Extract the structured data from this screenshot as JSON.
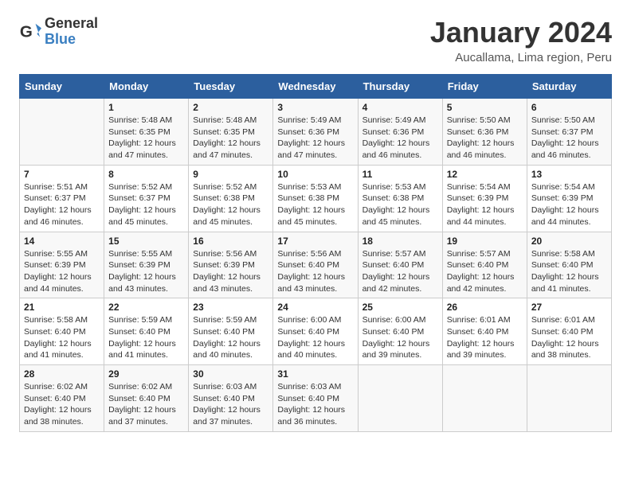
{
  "logo": {
    "text_general": "General",
    "text_blue": "Blue"
  },
  "title": "January 2024",
  "subtitle": "Aucallama, Lima region, Peru",
  "days_of_week": [
    "Sunday",
    "Monday",
    "Tuesday",
    "Wednesday",
    "Thursday",
    "Friday",
    "Saturday"
  ],
  "weeks": [
    [
      {
        "day": "",
        "info": ""
      },
      {
        "day": "1",
        "info": "Sunrise: 5:48 AM\nSunset: 6:35 PM\nDaylight: 12 hours\nand 47 minutes."
      },
      {
        "day": "2",
        "info": "Sunrise: 5:48 AM\nSunset: 6:35 PM\nDaylight: 12 hours\nand 47 minutes."
      },
      {
        "day": "3",
        "info": "Sunrise: 5:49 AM\nSunset: 6:36 PM\nDaylight: 12 hours\nand 47 minutes."
      },
      {
        "day": "4",
        "info": "Sunrise: 5:49 AM\nSunset: 6:36 PM\nDaylight: 12 hours\nand 46 minutes."
      },
      {
        "day": "5",
        "info": "Sunrise: 5:50 AM\nSunset: 6:36 PM\nDaylight: 12 hours\nand 46 minutes."
      },
      {
        "day": "6",
        "info": "Sunrise: 5:50 AM\nSunset: 6:37 PM\nDaylight: 12 hours\nand 46 minutes."
      }
    ],
    [
      {
        "day": "7",
        "info": "Sunrise: 5:51 AM\nSunset: 6:37 PM\nDaylight: 12 hours\nand 46 minutes."
      },
      {
        "day": "8",
        "info": "Sunrise: 5:52 AM\nSunset: 6:37 PM\nDaylight: 12 hours\nand 45 minutes."
      },
      {
        "day": "9",
        "info": "Sunrise: 5:52 AM\nSunset: 6:38 PM\nDaylight: 12 hours\nand 45 minutes."
      },
      {
        "day": "10",
        "info": "Sunrise: 5:53 AM\nSunset: 6:38 PM\nDaylight: 12 hours\nand 45 minutes."
      },
      {
        "day": "11",
        "info": "Sunrise: 5:53 AM\nSunset: 6:38 PM\nDaylight: 12 hours\nand 45 minutes."
      },
      {
        "day": "12",
        "info": "Sunrise: 5:54 AM\nSunset: 6:39 PM\nDaylight: 12 hours\nand 44 minutes."
      },
      {
        "day": "13",
        "info": "Sunrise: 5:54 AM\nSunset: 6:39 PM\nDaylight: 12 hours\nand 44 minutes."
      }
    ],
    [
      {
        "day": "14",
        "info": "Sunrise: 5:55 AM\nSunset: 6:39 PM\nDaylight: 12 hours\nand 44 minutes."
      },
      {
        "day": "15",
        "info": "Sunrise: 5:55 AM\nSunset: 6:39 PM\nDaylight: 12 hours\nand 43 minutes."
      },
      {
        "day": "16",
        "info": "Sunrise: 5:56 AM\nSunset: 6:39 PM\nDaylight: 12 hours\nand 43 minutes."
      },
      {
        "day": "17",
        "info": "Sunrise: 5:56 AM\nSunset: 6:40 PM\nDaylight: 12 hours\nand 43 minutes."
      },
      {
        "day": "18",
        "info": "Sunrise: 5:57 AM\nSunset: 6:40 PM\nDaylight: 12 hours\nand 42 minutes."
      },
      {
        "day": "19",
        "info": "Sunrise: 5:57 AM\nSunset: 6:40 PM\nDaylight: 12 hours\nand 42 minutes."
      },
      {
        "day": "20",
        "info": "Sunrise: 5:58 AM\nSunset: 6:40 PM\nDaylight: 12 hours\nand 41 minutes."
      }
    ],
    [
      {
        "day": "21",
        "info": "Sunrise: 5:58 AM\nSunset: 6:40 PM\nDaylight: 12 hours\nand 41 minutes."
      },
      {
        "day": "22",
        "info": "Sunrise: 5:59 AM\nSunset: 6:40 PM\nDaylight: 12 hours\nand 41 minutes."
      },
      {
        "day": "23",
        "info": "Sunrise: 5:59 AM\nSunset: 6:40 PM\nDaylight: 12 hours\nand 40 minutes."
      },
      {
        "day": "24",
        "info": "Sunrise: 6:00 AM\nSunset: 6:40 PM\nDaylight: 12 hours\nand 40 minutes."
      },
      {
        "day": "25",
        "info": "Sunrise: 6:00 AM\nSunset: 6:40 PM\nDaylight: 12 hours\nand 39 minutes."
      },
      {
        "day": "26",
        "info": "Sunrise: 6:01 AM\nSunset: 6:40 PM\nDaylight: 12 hours\nand 39 minutes."
      },
      {
        "day": "27",
        "info": "Sunrise: 6:01 AM\nSunset: 6:40 PM\nDaylight: 12 hours\nand 38 minutes."
      }
    ],
    [
      {
        "day": "28",
        "info": "Sunrise: 6:02 AM\nSunset: 6:40 PM\nDaylight: 12 hours\nand 38 minutes."
      },
      {
        "day": "29",
        "info": "Sunrise: 6:02 AM\nSunset: 6:40 PM\nDaylight: 12 hours\nand 37 minutes."
      },
      {
        "day": "30",
        "info": "Sunrise: 6:03 AM\nSunset: 6:40 PM\nDaylight: 12 hours\nand 37 minutes."
      },
      {
        "day": "31",
        "info": "Sunrise: 6:03 AM\nSunset: 6:40 PM\nDaylight: 12 hours\nand 36 minutes."
      },
      {
        "day": "",
        "info": ""
      },
      {
        "day": "",
        "info": ""
      },
      {
        "day": "",
        "info": ""
      }
    ]
  ]
}
